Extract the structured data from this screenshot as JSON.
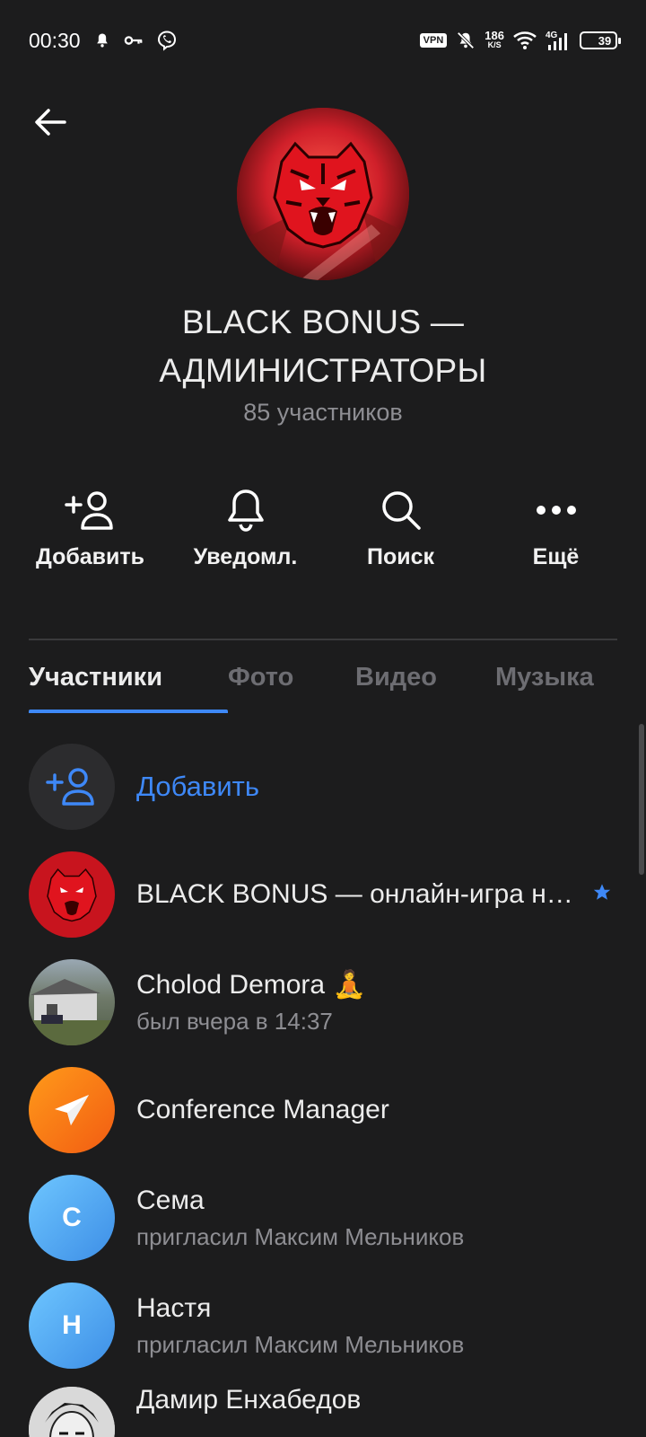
{
  "status_bar": {
    "time": "00:30",
    "vpn_label": "VPN",
    "net_speed_value": "186",
    "net_speed_unit": "K/S",
    "network_type": "4G",
    "battery_level": "39"
  },
  "group": {
    "title": "BLACK BONUS — АДМИНИСТРАТОРЫ",
    "subtitle": "85 участников"
  },
  "actions": {
    "add": "Добавить",
    "notifications": "Уведомл.",
    "search": "Поиск",
    "more": "Ещё"
  },
  "tabs": {
    "members": "Участники",
    "photo": "Фото",
    "video": "Видео",
    "music": "Музыка",
    "active": "members"
  },
  "add_member_label": "Добавить",
  "members": [
    {
      "name": "BLACK BONUS — онлайн-игра на Android",
      "status": "",
      "starred": true
    },
    {
      "name": "Cholod Demora 🧘",
      "status": "был вчера в 14:37"
    },
    {
      "name": "Conference Manager",
      "status": ""
    },
    {
      "name": "Сема",
      "status": "пригласил Максим Мельников",
      "initial": "С"
    },
    {
      "name": "Настя",
      "status": "пригласил Максим Мельников",
      "initial": "Н"
    },
    {
      "name": "Дамир Енхабедов",
      "status": ""
    }
  ],
  "colors": {
    "background": "#1c1c1d",
    "accent": "#3e88f7",
    "secondary_text": "#8e8e93"
  }
}
